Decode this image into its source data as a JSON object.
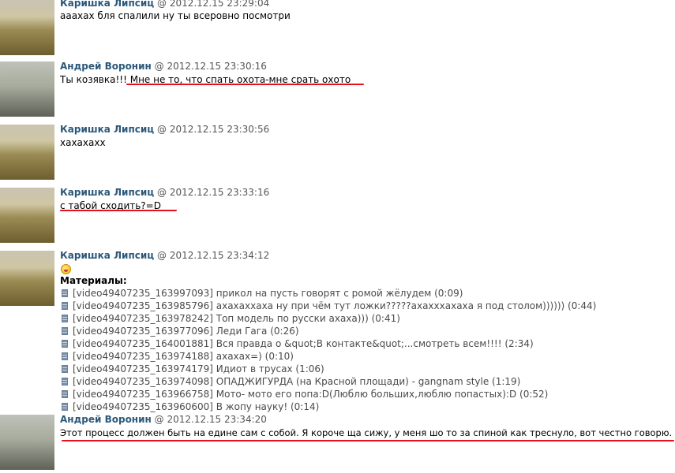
{
  "messages": [
    {
      "author": "Каришка Липсиц",
      "at": "@",
      "time": "2012.12.15 23:29:04",
      "text": "ааахах бля спалили ну ты всеровно посмотри"
    },
    {
      "author": "Андрей Воронин",
      "at": "@",
      "time": "2012.12.15 23:30:16",
      "text_prefix": "Ты козявка!!! ",
      "text_underlined": "Мне не то, что спать охота-мне срать охото"
    },
    {
      "author": "Каришка Липсиц",
      "at": "@",
      "time": "2012.12.15 23:30:56",
      "text": "хахахахх"
    },
    {
      "author": "Каришка Липсиц",
      "at": "@",
      "time": "2012.12.15 23:33:16",
      "text": "с табой сходить?=D"
    },
    {
      "author": "Каришка Липсиц",
      "at": "@",
      "time": "2012.12.15 23:34:12",
      "materials_label": "Материалы:",
      "materials": [
        "[video49407235_163997093] прикол на пусть говорят с ромой жёлудем (0:09)",
        "[video49407235_163985796] ахахаххаха ну при чём тут ложки?????ахахххахаха я под столом)))))) (0:44)",
        "[video49407235_163978242] Топ модель по русски ахаха))) (0:41)",
        "[video49407235_163977096] Леди Гага (0:26)",
        "[video49407235_164001881] Вся правда о &quot;В контакте&quot;...смотреть всем!!!! (2:34)",
        "[video49407235_163974188] ахахах=) (0:10)",
        "[video49407235_163974179] Идиот в трусах (1:06)",
        "[video49407235_163974098] ОПАДЖИГУРДА (на Красной площади) - gangnam style (1:19)",
        "[video49407235_163966758] Мото- мото его попа:D(Люблю больших,люблю попастых):D (0:52)",
        "[video49407235_163960600] В жопу науку! (0:14)"
      ]
    },
    {
      "author": "Андрей Воронин",
      "at": "@",
      "time": "2012.12.15 23:34:20",
      "text": "Этот процесс должен быть на едине сам с собой. Я короче ща сижу, у меня шо то за спиной как треснуло, вот честно говорю."
    }
  ],
  "colors": {
    "author": "#2b587a",
    "meta": "#555555",
    "underline": "#e3101d"
  },
  "icons": {
    "smiley": "smiley-icon",
    "video": "video-icon"
  }
}
